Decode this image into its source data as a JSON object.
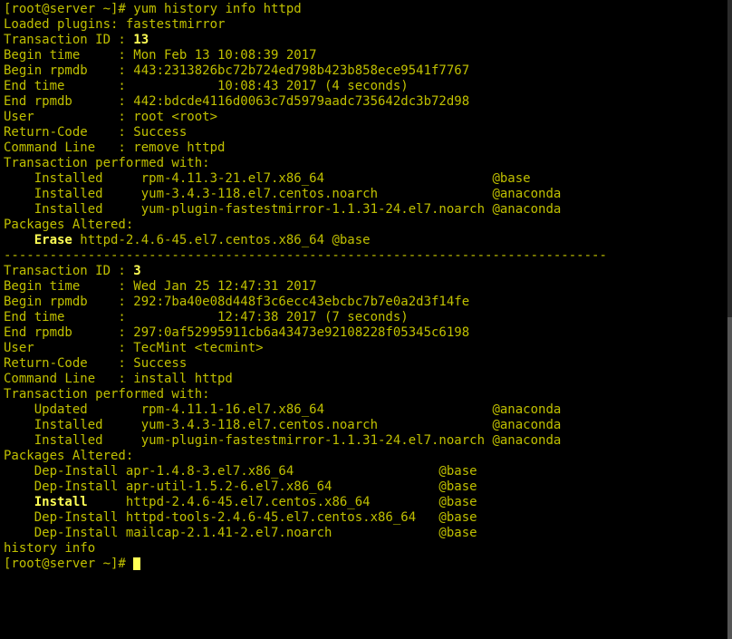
{
  "prompt1": "[root@server ~]# ",
  "cmd1": "yum history info httpd",
  "loaded": "Loaded plugins: fastestmirror",
  "t1": {
    "id_label": "Transaction ID : ",
    "id_value": "13",
    "begin_time": "Begin time     : Mon Feb 13 10:08:39 2017",
    "begin_rpmdb": "Begin rpmdb    : 443:2313826bc72b724ed798b423b858ece9541f7767",
    "end_time": "End time       :            10:08:43 2017 (4 seconds)",
    "end_rpmdb": "End rpmdb      : 442:bdcde4116d0063c7d5979aadc735642dc3b72d98",
    "user": "User           : root <root>",
    "return_code": "Return-Code    : Success",
    "cmd_line": "Command Line   : remove httpd",
    "tpw": "Transaction performed with:",
    "tpw1": "    Installed     rpm-4.11.3-21.el7.x86_64                      @base",
    "tpw2": "    Installed     yum-3.4.3-118.el7.centos.noarch               @anaconda",
    "tpw3": "    Installed     yum-plugin-fastestmirror-1.1.31-24.el7.noarch @anaconda",
    "pkg_alt": "Packages Altered:",
    "erase_pre": "    ",
    "erase_bold": "Erase",
    "erase_rest": " httpd-2.4.6-45.el7.centos.x86_64 @base"
  },
  "separator": "-------------------------------------------------------------------------------",
  "t2": {
    "id_label": "Transaction ID : ",
    "id_value": "3",
    "begin_time": "Begin time     : Wed Jan 25 12:47:31 2017",
    "begin_rpmdb": "Begin rpmdb    : 292:7ba40e08d448f3c6ecc43ebcbc7b7e0a2d3f14fe",
    "end_time": "End time       :            12:47:38 2017 (7 seconds)",
    "end_rpmdb": "End rpmdb      : 297:0af52995911cb6a43473e92108228f05345c6198",
    "user": "User           : TecMint <tecmint>",
    "return_code": "Return-Code    : Success",
    "cmd_line": "Command Line   : install httpd",
    "tpw": "Transaction performed with:",
    "tpw1": "    Updated       rpm-4.11.1-16.el7.x86_64                      @anaconda",
    "tpw2": "    Installed     yum-3.4.3-118.el7.centos.noarch               @anaconda",
    "tpw3": "    Installed     yum-plugin-fastestmirror-1.1.31-24.el7.noarch @anaconda",
    "pkg_alt": "Packages Altered:",
    "dep1": "    Dep-Install apr-1.4.8-3.el7.x86_64                   @base",
    "dep2": "    Dep-Install apr-util-1.5.2-6.el7.x86_64              @base",
    "install_pre": "    ",
    "install_bold": "Install",
    "install_rest": "     httpd-2.4.6-45.el7.centos.x86_64         @base",
    "dep3": "    Dep-Install httpd-tools-2.4.6-45.el7.centos.x86_64   @base",
    "dep4": "    Dep-Install mailcap-2.1.41-2.el7.noarch              @base"
  },
  "footer": "history info",
  "prompt2": "[root@server ~]# ",
  "chart_data": {
    "type": "table",
    "title": "yum history info httpd",
    "transactions": [
      {
        "id": 13,
        "begin_time": "Mon Feb 13 10:08:39 2017",
        "begin_rpmdb": "443:2313826bc72b724ed798b423b858ece9541f7767",
        "end_time": "10:08:43 2017",
        "duration_seconds": 4,
        "end_rpmdb": "442:bdcde4116d0063c7d5979aadc735642dc3b72d98",
        "user": "root <root>",
        "return_code": "Success",
        "command_line": "remove httpd",
        "performed_with": [
          {
            "state": "Installed",
            "package": "rpm-4.11.3-21.el7.x86_64",
            "repo": "@base"
          },
          {
            "state": "Installed",
            "package": "yum-3.4.3-118.el7.centos.noarch",
            "repo": "@anaconda"
          },
          {
            "state": "Installed",
            "package": "yum-plugin-fastestmirror-1.1.31-24.el7.noarch",
            "repo": "@anaconda"
          }
        ],
        "packages_altered": [
          {
            "action": "Erase",
            "package": "httpd-2.4.6-45.el7.centos.x86_64",
            "repo": "@base"
          }
        ]
      },
      {
        "id": 3,
        "begin_time": "Wed Jan 25 12:47:31 2017",
        "begin_rpmdb": "292:7ba40e08d448f3c6ecc43ebcbc7b7e0a2d3f14fe",
        "end_time": "12:47:38 2017",
        "duration_seconds": 7,
        "end_rpmdb": "297:0af52995911cb6a43473e92108228f05345c6198",
        "user": "TecMint <tecmint>",
        "return_code": "Success",
        "command_line": "install httpd",
        "performed_with": [
          {
            "state": "Updated",
            "package": "rpm-4.11.1-16.el7.x86_64",
            "repo": "@anaconda"
          },
          {
            "state": "Installed",
            "package": "yum-3.4.3-118.el7.centos.noarch",
            "repo": "@anaconda"
          },
          {
            "state": "Installed",
            "package": "yum-plugin-fastestmirror-1.1.31-24.el7.noarch",
            "repo": "@anaconda"
          }
        ],
        "packages_altered": [
          {
            "action": "Dep-Install",
            "package": "apr-1.4.8-3.el7.x86_64",
            "repo": "@base"
          },
          {
            "action": "Dep-Install",
            "package": "apr-util-1.5.2-6.el7.x86_64",
            "repo": "@base"
          },
          {
            "action": "Install",
            "package": "httpd-2.4.6-45.el7.centos.x86_64",
            "repo": "@base"
          },
          {
            "action": "Dep-Install",
            "package": "httpd-tools-2.4.6-45.el7.centos.x86_64",
            "repo": "@base"
          },
          {
            "action": "Dep-Install",
            "package": "mailcap-2.1.41-2.el7.noarch",
            "repo": "@base"
          }
        ]
      }
    ]
  }
}
